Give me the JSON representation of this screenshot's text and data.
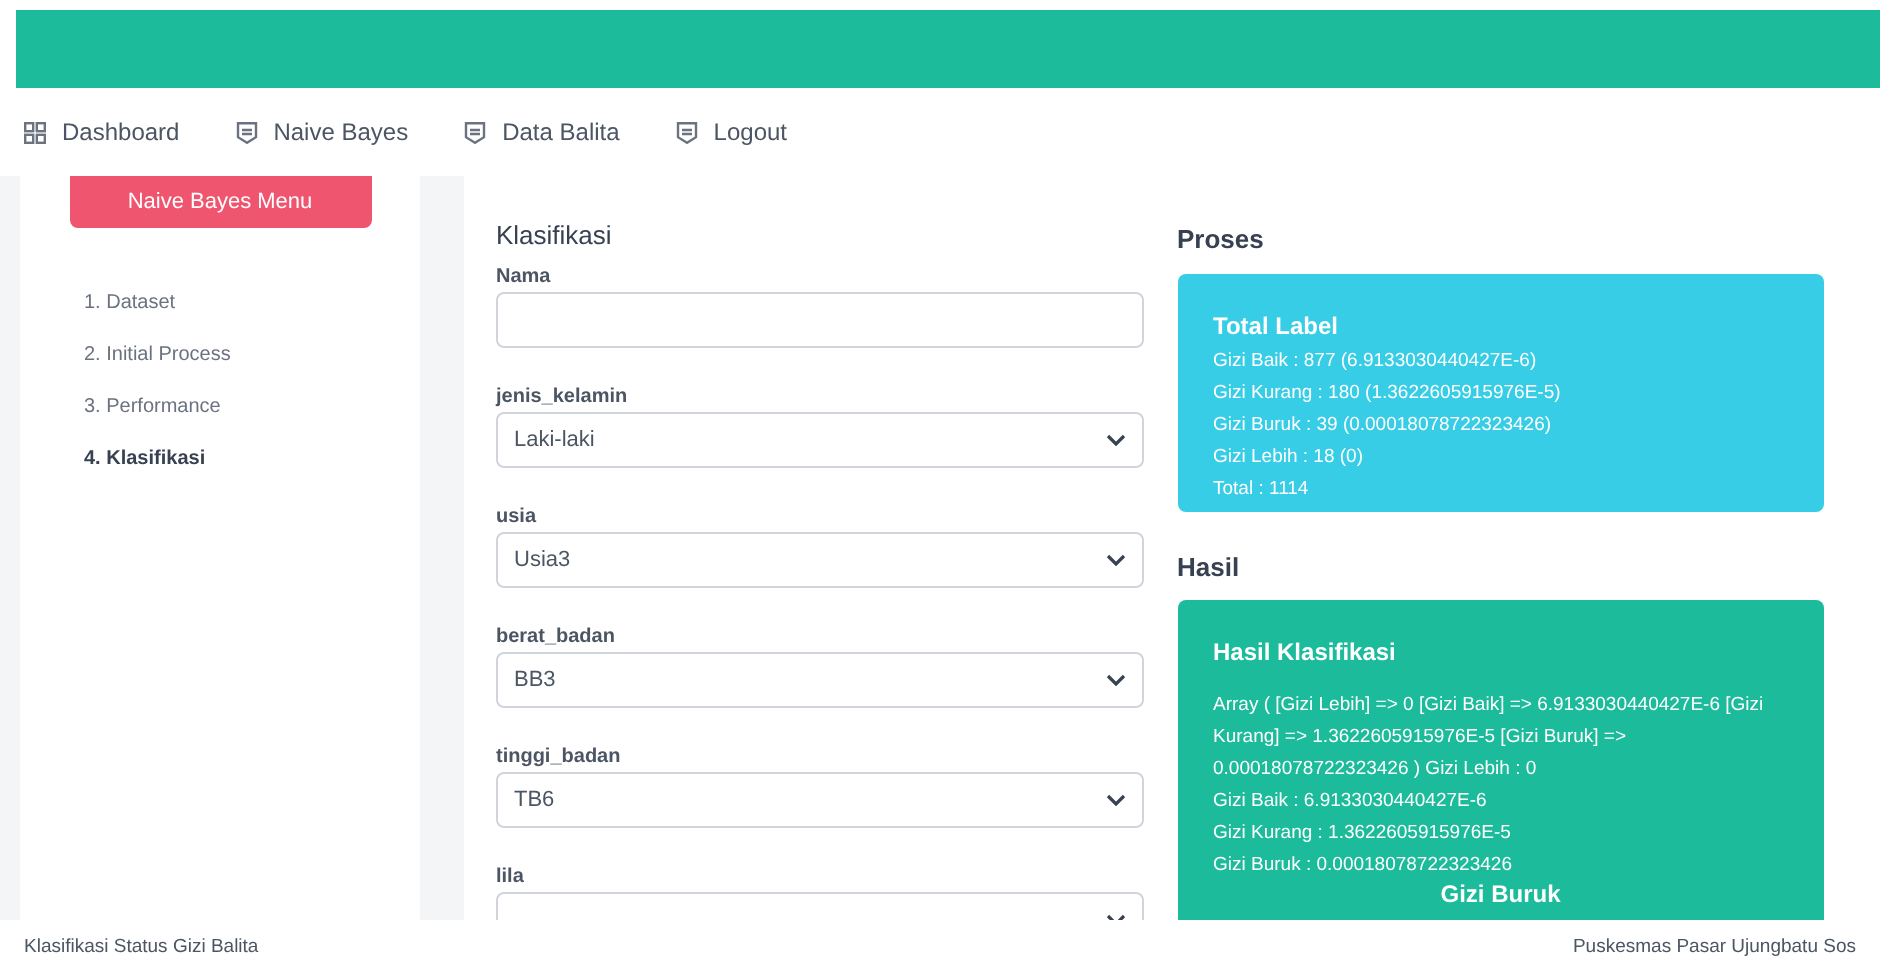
{
  "nav": [
    {
      "label": "Dashboard",
      "kind": "grid"
    },
    {
      "label": "Naive Bayes",
      "kind": "doc"
    },
    {
      "label": "Data Balita",
      "kind": "doc"
    },
    {
      "label": "Logout",
      "kind": "doc"
    }
  ],
  "sidebar": {
    "button": "Naive Bayes Menu",
    "items": [
      {
        "label": "1. Dataset",
        "selected": false
      },
      {
        "label": "2. Initial Process",
        "selected": false
      },
      {
        "label": "3. Performance",
        "selected": false
      },
      {
        "label": "4. Klasifikasi",
        "selected": true
      }
    ]
  },
  "form": {
    "title": "Klasifikasi",
    "fields": [
      {
        "label": "Nama",
        "kind": "text"
      },
      {
        "label": "jenis_kelamin",
        "kind": "select",
        "value": "Laki-laki"
      },
      {
        "label": "usia",
        "kind": "select",
        "value": "Usia3"
      },
      {
        "label": "berat_badan",
        "kind": "select",
        "value": "BB3"
      },
      {
        "label": "tinggi_badan",
        "kind": "select",
        "value": "TB6"
      },
      {
        "label": "lila",
        "kind": "select"
      }
    ]
  },
  "proses": {
    "heading": "Proses",
    "title": "Total Label",
    "lines": [
      "Gizi Baik : 877 (6.9133030440427E-6)",
      "Gizi Kurang : 180 (1.3622605915976E-5)",
      "Gizi Buruk : 39 (0.00018078722323426)",
      "Gizi Lebih : 18 (0)",
      "Total : 1114"
    ]
  },
  "hasil": {
    "heading": "Hasil",
    "title": "Hasil Klasifikasi",
    "lines": [
      "Array ( [Gizi Lebih] => 0 [Gizi Baik] => 6.9133030440427E-6 [Gizi Kurang] => 1.3622605915976E-5 [Gizi Buruk] => 0.00018078722323426 ) Gizi Lebih : 0",
      "Gizi Baik : 6.9133030440427E-6",
      "Gizi Kurang : 1.3622605915976E-5",
      "Gizi Buruk : 0.00018078722323426"
    ],
    "result": "Gizi Buruk"
  },
  "footer": {
    "left": "Klasifikasi Status Gizi Balita",
    "right": "Puskesmas Pasar Ujungbatu Sos"
  }
}
